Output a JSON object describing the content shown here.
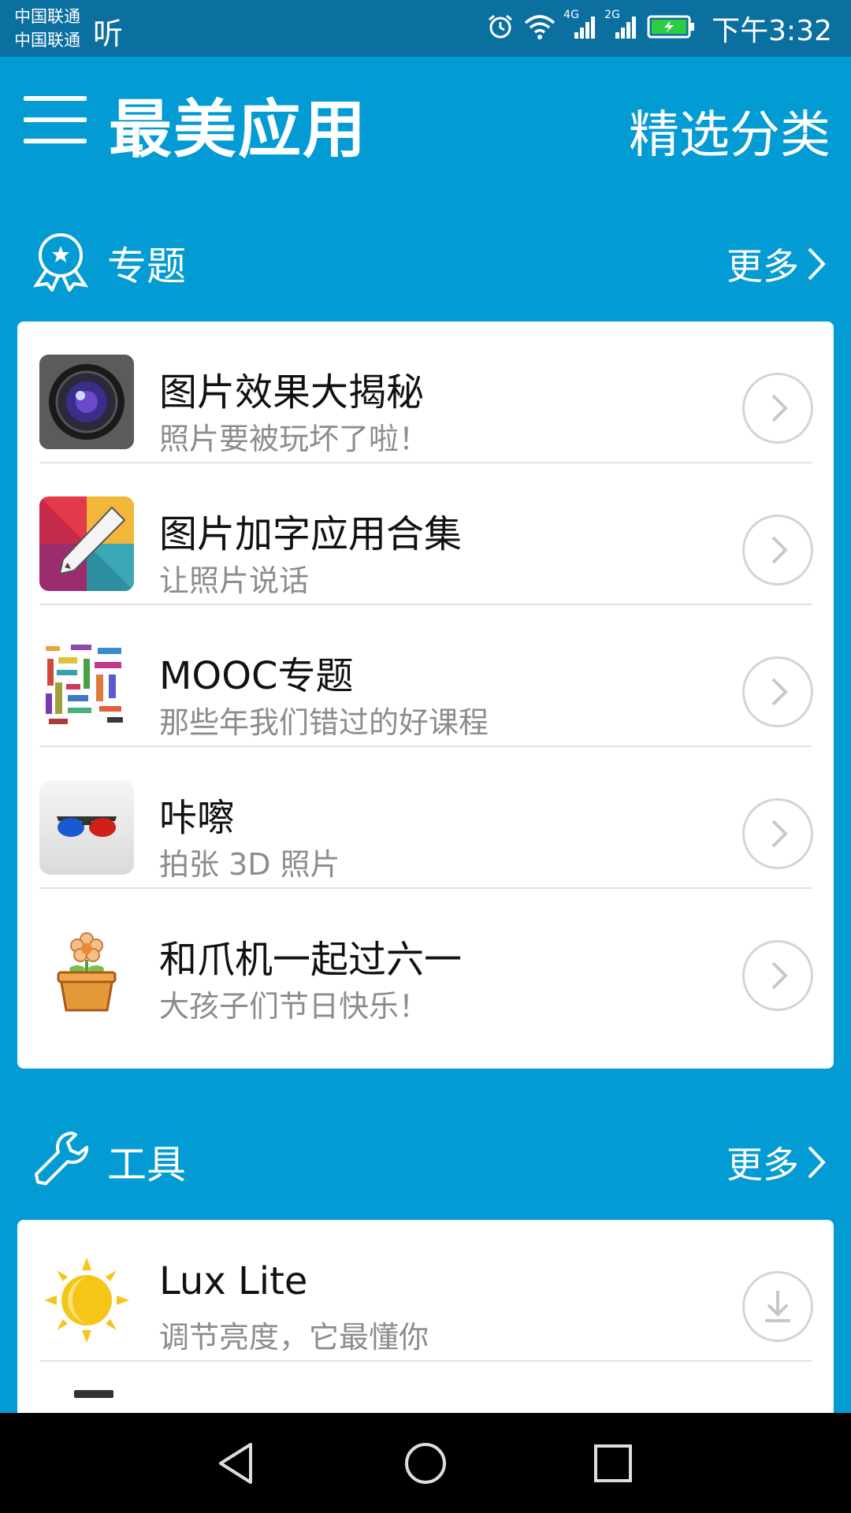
{
  "status_bar": {
    "carrier_1": "中国联通",
    "carrier_2": "中国联通",
    "listen_label": "听",
    "network_1": "4G",
    "network_2": "2G",
    "time": "下午3:32",
    "icons": [
      "alarm-icon",
      "wifi-icon",
      "signal-icon",
      "signal-icon",
      "battery-charging-icon"
    ]
  },
  "header": {
    "app_title": "最美应用",
    "category_link": "精选分类"
  },
  "sections": {
    "topics": {
      "title": "专题",
      "more": "更多",
      "icon": "award-ribbon-icon",
      "items": [
        {
          "title": "图片效果大揭秘",
          "subtitle": "照片要被玩坏了啦！",
          "icon": "camera-lens-icon"
        },
        {
          "title": "图片加字应用合集",
          "subtitle": "让照片说话",
          "icon": "pencil-mosaic-icon"
        },
        {
          "title": "MOOC专题",
          "subtitle": "那些年我们错过的好课程",
          "icon": "word-cloud-icon"
        },
        {
          "title": "咔嚓",
          "subtitle": "拍张 3D 照片",
          "icon": "3d-glasses-icon"
        },
        {
          "title": "和爪机一起过六一",
          "subtitle": "大孩子们节日快乐！",
          "icon": "flower-pot-icon"
        }
      ]
    },
    "tools": {
      "title": "工具",
      "more": "更多",
      "icon": "wrench-icon",
      "items": [
        {
          "title": "Lux Lite",
          "subtitle": "调节亮度，它最懂你",
          "icon": "sun-moon-icon"
        }
      ]
    }
  },
  "colors": {
    "background": "#039bd3",
    "status_bar": "#0b6fa0",
    "card": "#ffffff",
    "title_text": "#111111",
    "subtitle_text": "#8c8c8c"
  }
}
